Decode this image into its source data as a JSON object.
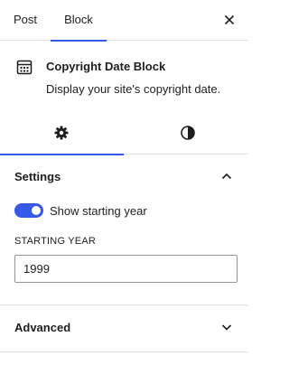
{
  "top_tabs": {
    "post": "Post",
    "block": "Block"
  },
  "block_card": {
    "title": "Copyright Date Block",
    "description": "Display your site's copyright date.",
    "icon": "calendar-icon"
  },
  "inspector_tabs": {
    "settings_icon": "gear-icon",
    "styles_icon": "contrast-icon"
  },
  "settings_panel": {
    "title": "Settings",
    "expanded": true,
    "toggle_label": "Show starting year",
    "toggle_on": true,
    "field_label": "STARTING YEAR",
    "field_value": "1999"
  },
  "advanced_panel": {
    "title": "Advanced",
    "expanded": false
  },
  "colors": {
    "accent": "#3858e9",
    "border": "#e0e0e0",
    "text": "#1e1e1e"
  }
}
